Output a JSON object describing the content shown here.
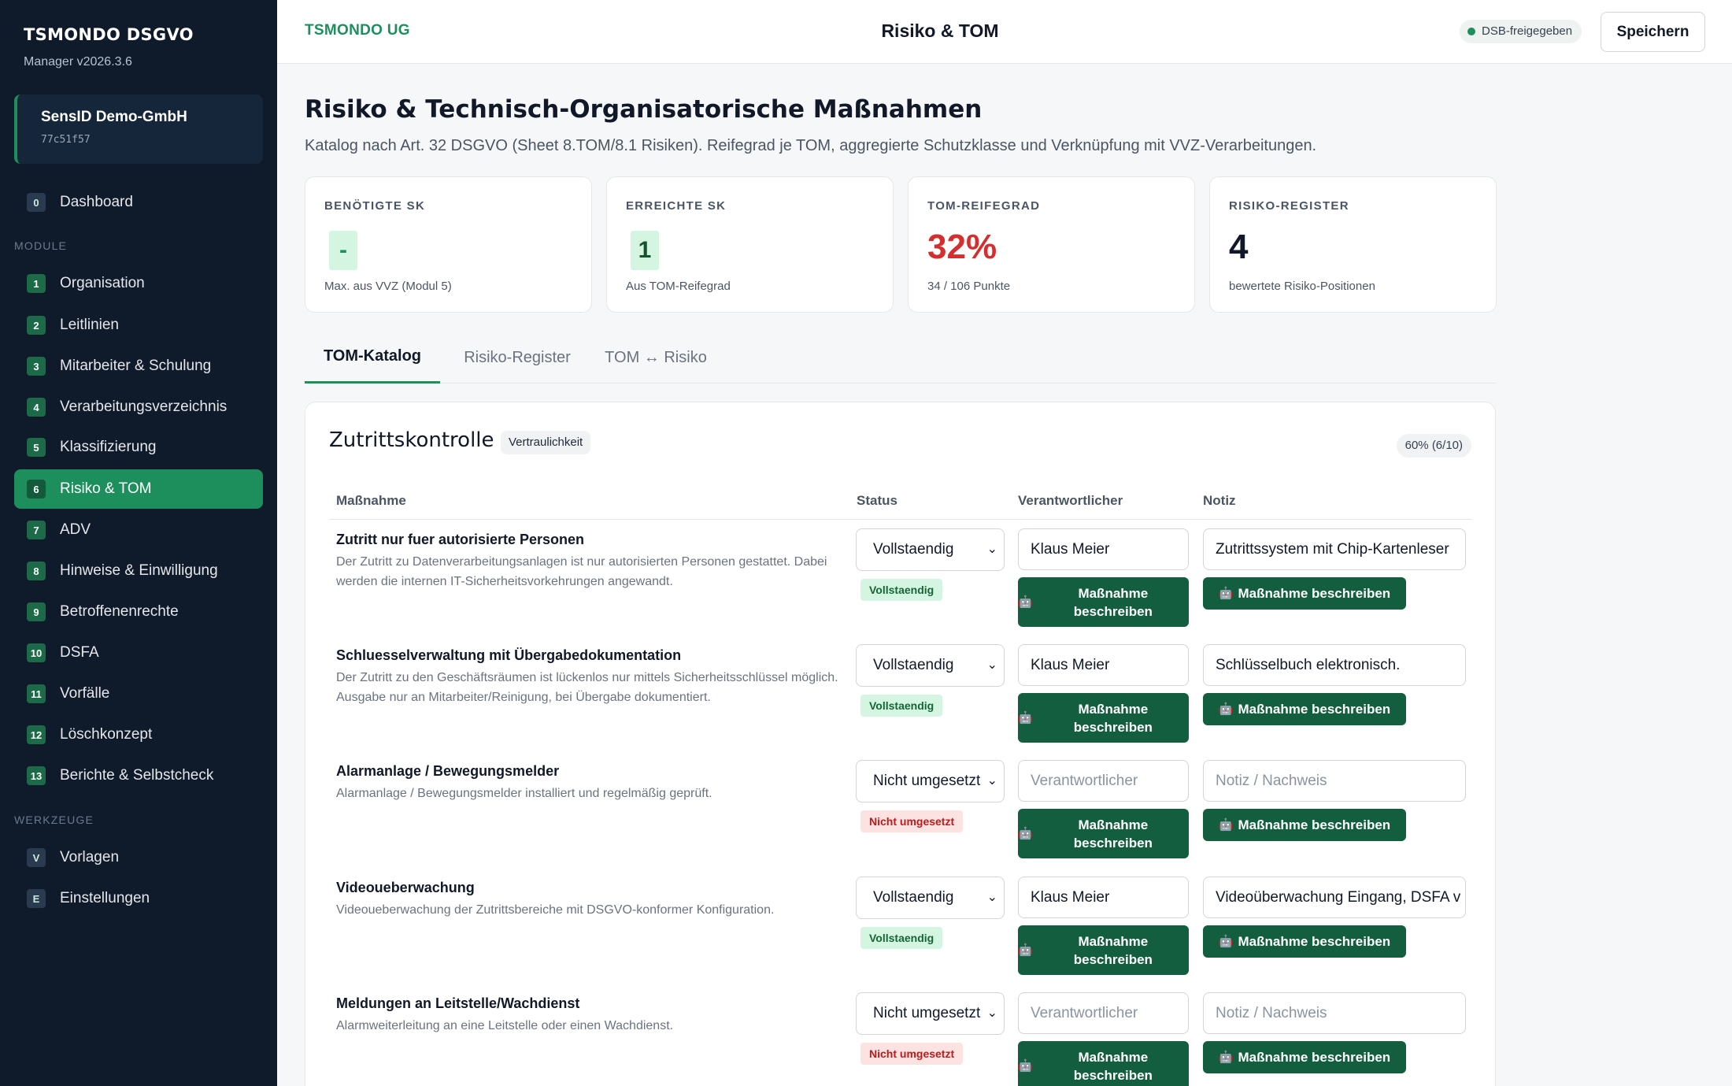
{
  "brand": {
    "title": "TSMONDO DSGVO",
    "version": "Manager v2026.3.6"
  },
  "tenant": {
    "name": "SensID Demo-GmbH",
    "id": "77c51f57"
  },
  "nav": {
    "dashboard": {
      "num": "0",
      "label": "Dashboard"
    },
    "section_module": "MODULE",
    "items": [
      {
        "num": "1",
        "label": "Organisation"
      },
      {
        "num": "2",
        "label": "Leitlinien"
      },
      {
        "num": "3",
        "label": "Mitarbeiter & Schulung"
      },
      {
        "num": "4",
        "label": "Verarbeitungsverzeichnis"
      },
      {
        "num": "5",
        "label": "Klassifizierung"
      },
      {
        "num": "6",
        "label": "Risiko & TOM"
      },
      {
        "num": "7",
        "label": "ADV"
      },
      {
        "num": "8",
        "label": "Hinweise & Einwilligung"
      },
      {
        "num": "9",
        "label": "Betroffenenrechte"
      },
      {
        "num": "10",
        "label": "DSFA"
      },
      {
        "num": "11",
        "label": "Vorfälle"
      },
      {
        "num": "12",
        "label": "Löschkonzept"
      },
      {
        "num": "13",
        "label": "Berichte & Selbstcheck"
      }
    ],
    "section_tools": "WERKZEUGE",
    "tools": [
      {
        "num": "V",
        "label": "Vorlagen"
      },
      {
        "num": "E",
        "label": "Einstellungen"
      }
    ]
  },
  "topbar": {
    "company": "TSMONDO UG",
    "title": "Risiko & TOM",
    "badge": "DSB-freigegeben",
    "save": "Speichern"
  },
  "page": {
    "title": "Risiko & Technisch-Organisatorische Maßnahmen",
    "subtitle": "Katalog nach Art. 32 DSGVO (Sheet 8.TOM/8.1 Risiken). Reifegrad je TOM, aggregierte Schutzklasse und Verknüpfung mit VVZ-Verarbeitungen."
  },
  "cards": [
    {
      "label": "BENÖTIGTE SK",
      "value": "-",
      "note": "Max. aus VVZ (Modul 5)"
    },
    {
      "label": "ERREICHTE SK",
      "value": "1",
      "note": "Aus TOM-Reifegrad"
    },
    {
      "label": "TOM-REIFEGRAD",
      "value": "32%",
      "note": "34 / 106 Punkte"
    },
    {
      "label": "RISIKO-REGISTER",
      "value": "4",
      "note": "bewertete Risiko-Positionen"
    }
  ],
  "colors": {
    "accent": "#1d8f5c",
    "danger": "#d32f2f",
    "sidebar": "#0f1a2b"
  },
  "tabs": [
    "TOM-Katalog",
    "Risiko-Register",
    "TOM ↔ Risiko"
  ],
  "section": {
    "title": "Zutrittskontrolle",
    "tag": "Vertraulichkeit",
    "progress": "60% (6/10)",
    "headers": {
      "measure": "Maßnahme",
      "status": "Status",
      "owner": "Verantwortlicher",
      "note": "Notiz"
    },
    "button_label": "Maßnahme beschreiben",
    "rows": [
      {
        "title": "Zutritt nur fuer autorisierte Personen",
        "desc": "Der Zutritt zu Datenverarbeitungsanlagen ist nur autorisierten Personen gestattet. Dabei werden die internen IT-Sicherheitsvorkehrungen angewandt.",
        "status": "Vollstaendig",
        "badge": "Vollstaendig",
        "owner": "Klaus Meier",
        "owner_placeholder": "",
        "note": "Zutrittssystem mit Chip-Kartenleser",
        "note_placeholder": ""
      },
      {
        "title": "Schluesselverwaltung mit Übergabedokumentation",
        "desc": "Der Zutritt zu den Geschäftsräumen ist lückenlos nur mittels Sicherheitsschlüssel möglich. Ausgabe nur an Mitarbeiter/Reinigung, bei Übergabe dokumentiert.",
        "status": "Vollstaendig",
        "badge": "Vollstaendig",
        "owner": "Klaus Meier",
        "owner_placeholder": "",
        "note": "Schlüsselbuch elektronisch.",
        "note_placeholder": ""
      },
      {
        "title": "Alarmanlage / Bewegungsmelder",
        "desc": "Alarmanlage / Bewegungsmelder installiert und regelmäßig geprüft.",
        "status": "Nicht umgesetzt",
        "badge": "Nicht umgesetzt",
        "owner": "",
        "owner_placeholder": "Verantwortlicher",
        "note": "",
        "note_placeholder": "Notiz / Nachweis"
      },
      {
        "title": "Videoueberwachung",
        "desc": "Videoueberwachung der Zutrittsbereiche mit DSGVO-konformer Konfiguration.",
        "status": "Vollstaendig",
        "badge": "Vollstaendig",
        "owner": "Klaus Meier",
        "owner_placeholder": "",
        "note": "Videoüberwachung Eingang, DSFA v",
        "note_placeholder": ""
      },
      {
        "title": "Meldungen an Leitstelle/Wachdienst",
        "desc": "Alarmweiterleitung an eine Leitstelle oder einen Wachdienst.",
        "status": "Nicht umgesetzt",
        "badge": "Nicht umgesetzt",
        "owner": "",
        "owner_placeholder": "Verantwortlicher",
        "note": "",
        "note_placeholder": "Notiz / Nachweis"
      }
    ]
  }
}
